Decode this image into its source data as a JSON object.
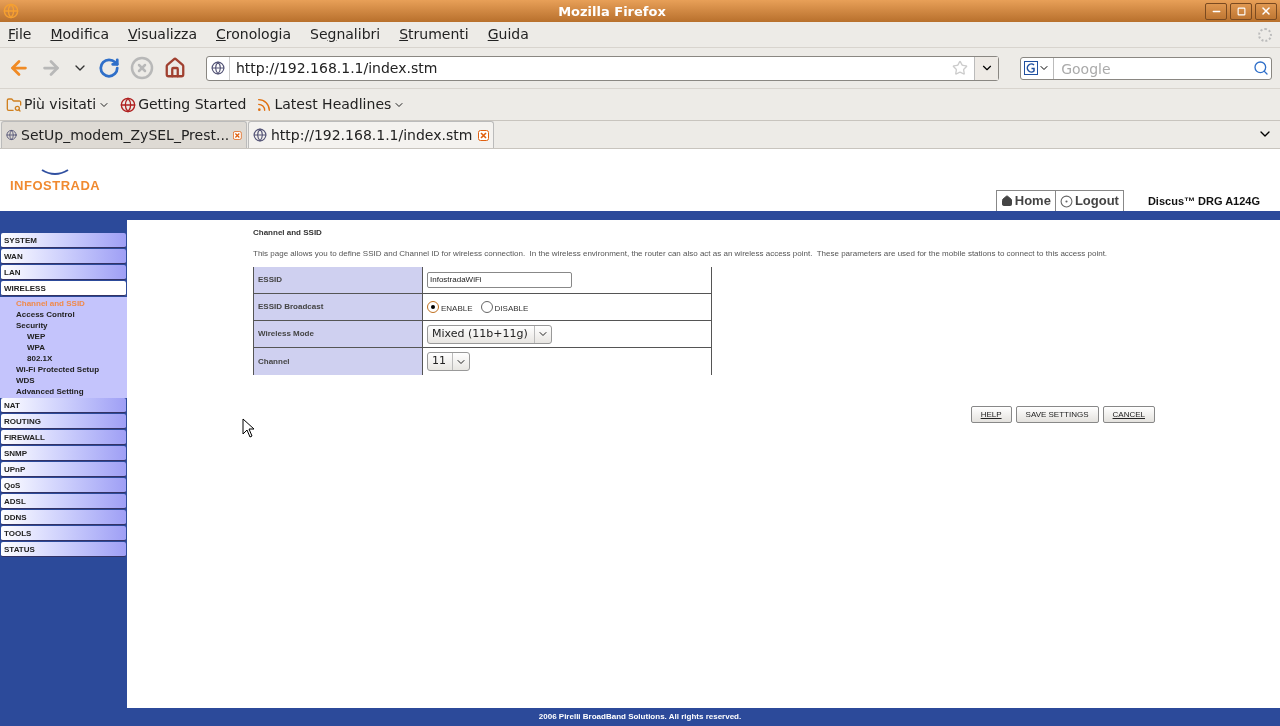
{
  "window": {
    "title": "Mozilla Firefox"
  },
  "menu": [
    {
      "key": "F",
      "after": "ile"
    },
    {
      "key": "M",
      "after": "odifica"
    },
    {
      "key": "V",
      "after": "isualizza"
    },
    {
      "key": "C",
      "after": "ronologia"
    },
    {
      "before": "Se",
      "key": "g",
      "after": "nalibri"
    },
    {
      "key": "S",
      "after": "trumenti"
    },
    {
      "key": "G",
      "after": "uida"
    }
  ],
  "nav_buttons": [
    {
      "kind": "back",
      "disabled": false
    },
    {
      "kind": "forward",
      "disabled": true
    },
    {
      "kind": "history",
      "disabled": false
    },
    {
      "kind": "reload",
      "disabled": false
    },
    {
      "kind": "stop",
      "disabled": true
    },
    {
      "kind": "home",
      "disabled": false
    }
  ],
  "address": {
    "value": "http://192.168.1.1/index.stm"
  },
  "search": {
    "placeholder": "Google"
  },
  "bookmarks": [
    {
      "kind": "folder",
      "label": "Più visitati",
      "dropdown": true
    },
    {
      "kind": "page",
      "label": "Getting Started",
      "dropdown": false
    },
    {
      "kind": "feed",
      "label": "Latest Headlines",
      "dropdown": true
    }
  ],
  "tabs": [
    {
      "label": "SetUp_modem_ZySEL_Prest...",
      "selected": false
    },
    {
      "label": "http://192.168.1.1/index.stm",
      "selected": true
    }
  ],
  "page": {
    "logo": "INFOSTRADA",
    "links": [
      {
        "kind": "home",
        "label": "Home"
      },
      {
        "kind": "logout",
        "label": "Logout"
      }
    ],
    "model": "Discus™ DRG A124G",
    "sidebar": [
      {
        "label": "SYSTEM",
        "expanded": false
      },
      {
        "label": "WAN",
        "expanded": false
      },
      {
        "label": "LAN",
        "expanded": false
      },
      {
        "label": "WIRELESS",
        "expanded": true,
        "children": [
          {
            "label": "Channel and SSID",
            "selected": true
          },
          {
            "label": "Access Control",
            "selected": false
          },
          {
            "label": "Security",
            "selected": false,
            "children": [
              {
                "label": "WEP",
                "selected": false
              },
              {
                "label": "WPA",
                "selected": false
              },
              {
                "label": "802.1X",
                "selected": false
              }
            ]
          },
          {
            "label": "Wi-Fi Protected Setup",
            "selected": false
          },
          {
            "label": "WDS",
            "selected": false
          },
          {
            "label": "Advanced Setting",
            "selected": false
          }
        ]
      },
      {
        "label": "NAT",
        "expanded": false
      },
      {
        "label": "ROUTING",
        "expanded": false
      },
      {
        "label": "FIREWALL",
        "expanded": false
      },
      {
        "label": "SNMP",
        "expanded": false
      },
      {
        "label": "UPnP",
        "expanded": false
      },
      {
        "label": "QoS",
        "expanded": false
      },
      {
        "label": "ADSL",
        "expanded": false
      },
      {
        "label": "DDNS",
        "expanded": false
      },
      {
        "label": "TOOLS",
        "expanded": false
      },
      {
        "label": "STATUS",
        "expanded": false
      }
    ],
    "heading": "Channel and SSID",
    "description": "This page allows you to define SSID and Channel ID for wireless connection.  In the wireless environment, the router can also act as an wireless access point.  These parameters are used for the mobile stations to connect to this access point.",
    "form": [
      {
        "kind": "text",
        "label": "ESSID",
        "value": "InfostradaWiFi"
      },
      {
        "kind": "radio",
        "label": "ESSID Broadcast",
        "options": [
          {
            "label": "ENABLE",
            "selected": true
          },
          {
            "label": "DISABLE",
            "selected": false
          }
        ]
      },
      {
        "kind": "select",
        "label": "Wireless Mode",
        "value": "Mixed (11b+11g)"
      },
      {
        "kind": "select",
        "label": "Channel",
        "value": "11"
      }
    ],
    "buttons": [
      {
        "label": "HELP",
        "underlined": true
      },
      {
        "label": "SAVE SETTINGS",
        "underlined": false
      },
      {
        "label": "CANCEL",
        "underlined": true
      }
    ],
    "footer": "2006 Pirelli BroadBand Solutions. All rights reserved."
  }
}
